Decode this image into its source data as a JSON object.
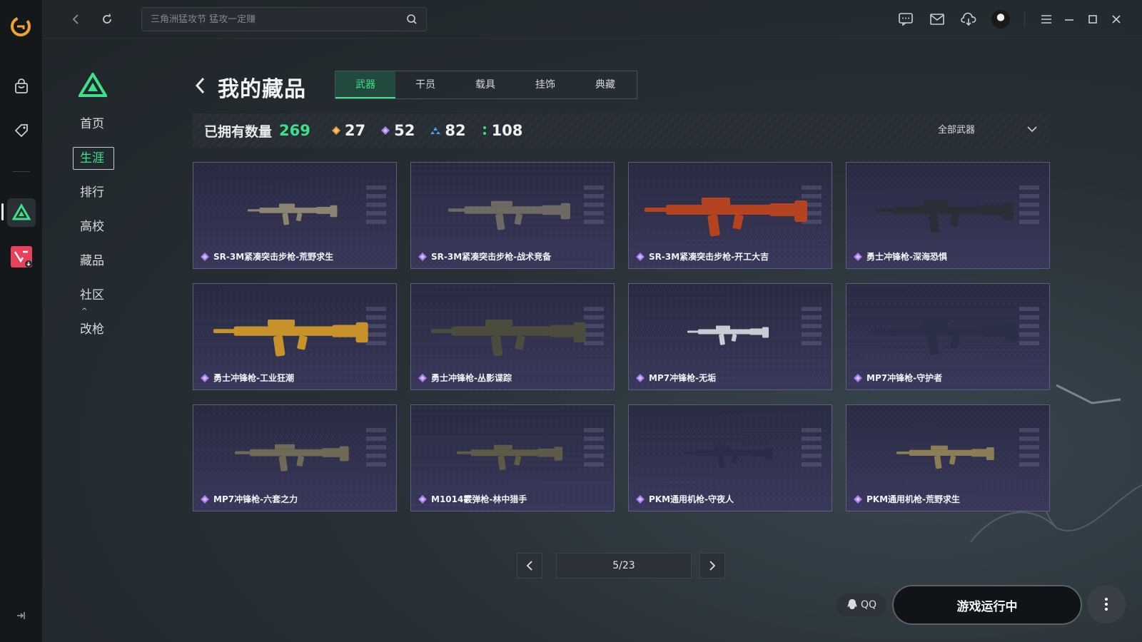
{
  "colors": {
    "accent": "#3ee08a",
    "gold": "#e79a3a",
    "purple": "#a77bef",
    "blue": "#4aa3f0",
    "green_gem": "#3ee08a"
  },
  "rail": {
    "items": [
      {
        "icon": "app-logo-icon"
      },
      {
        "icon": "shopping-bag-icon"
      },
      {
        "icon": "game-tag-icon"
      },
      {
        "icon": "delta-force-icon"
      },
      {
        "icon": "valorant-download-icon"
      }
    ]
  },
  "topbar": {
    "search_placeholder": "三角洲猛攻节 猛攻一定赚",
    "icons": [
      "back-icon",
      "refresh-icon",
      "search-icon",
      "chat-icon",
      "mail-icon",
      "download-icon",
      "avatar",
      "menu-icon",
      "minimize-icon",
      "maximize-icon",
      "close-icon"
    ]
  },
  "sidebar": {
    "items": [
      {
        "label": "首页"
      },
      {
        "label": "生涯"
      },
      {
        "label": "排行"
      },
      {
        "label": "高校"
      },
      {
        "label": "藏品"
      },
      {
        "label": "社区",
        "caret": "^"
      },
      {
        "label": "改枪"
      }
    ]
  },
  "header": {
    "title": "我的藏品",
    "tabs": [
      {
        "label": "武器"
      },
      {
        "label": "干员"
      },
      {
        "label": "载具"
      },
      {
        "label": "挂饰"
      },
      {
        "label": "典藏"
      }
    ]
  },
  "stats": {
    "owned_label": "已拥有数量",
    "owned_total": "269",
    "rarity_counts": [
      {
        "value": "27",
        "color": "#e79a3a"
      },
      {
        "value": "52",
        "color": "#a77bef"
      },
      {
        "value": "82",
        "color": "#4aa3f0"
      },
      {
        "value": "108",
        "color": "#3ee08a"
      }
    ],
    "filter_label": "全部武器"
  },
  "items": [
    {
      "name": "SR-3M紧凑突击步枪-荒野求生",
      "tone": "#8a8470"
    },
    {
      "name": "SR-3M紧凑突击步枪-战术竞备",
      "tone": "#6c6a62"
    },
    {
      "name": "SR-3M紧凑突击步枪-开工大吉",
      "tone": "#b5431f"
    },
    {
      "name": "勇士冲锋枪-深海恐惧",
      "tone": "#2b2e36"
    },
    {
      "name": "勇士冲锋枪-工业狂潮",
      "tone": "#c8922a"
    },
    {
      "name": "勇士冲锋枪-丛影谍踪",
      "tone": "#4c4c3e"
    },
    {
      "name": "MP7冲锋枪-无垢",
      "tone": "#c9ccd2"
    },
    {
      "name": "MP7冲锋枪-守护者",
      "tone": "#2a2f45"
    },
    {
      "name": "MP7冲锋枪-六套之力",
      "tone": "#6f6a58"
    },
    {
      "name": "M1014霰弹枪-林中猎手",
      "tone": "#5d5a47"
    },
    {
      "name": "PKM通用机枪-守夜人",
      "tone": "#2a2c48"
    },
    {
      "name": "PKM通用机枪-荒野求生",
      "tone": "#8b7d55"
    }
  ],
  "pagination": {
    "page": "5/23"
  },
  "bottom": {
    "qq_label": "QQ",
    "run_label": "游戏运行中"
  }
}
